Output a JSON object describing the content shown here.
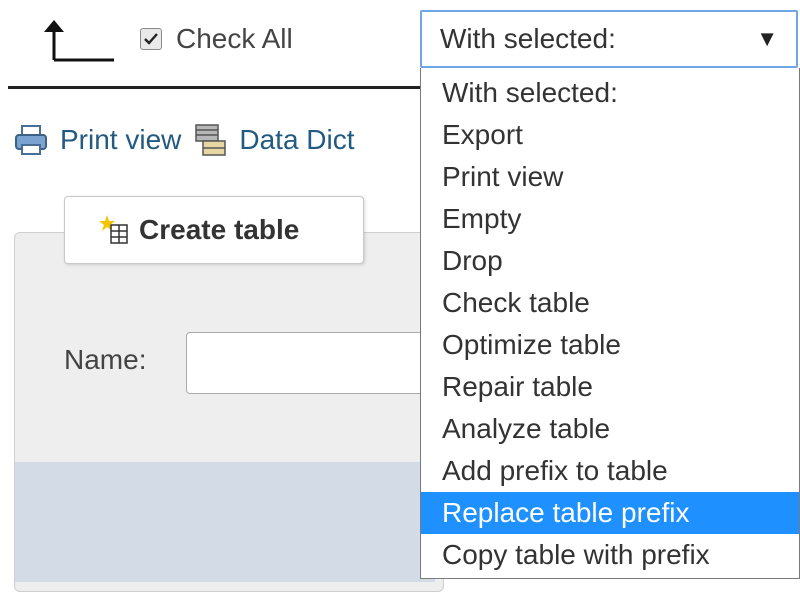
{
  "top": {
    "check_all_label": "Check All",
    "with_selected_value": "With selected:",
    "dropdown_arrow": "▼"
  },
  "tools": {
    "print_view": "Print view",
    "data_dictionary": "Data Dict"
  },
  "create_table": {
    "legend": "Create table",
    "name_label": "Name:"
  },
  "dropdown": {
    "options": [
      "With selected:",
      "Export",
      "Print view",
      "Empty",
      "Drop",
      "Check table",
      "Optimize table",
      "Repair table",
      "Analyze table",
      "Add prefix to table",
      "Replace table prefix",
      "Copy table with prefix"
    ],
    "highlighted_option": "Replace table prefix"
  },
  "colors": {
    "highlight": "#1e90ff",
    "link": "#235a81",
    "focus_border": "#6fa6e6"
  },
  "icons": [
    "arrow-up-left-icon",
    "checkbox-checked-icon",
    "print-icon",
    "data-dictionary-icon",
    "create-table-icon",
    "dropdown-arrow-icon"
  ]
}
